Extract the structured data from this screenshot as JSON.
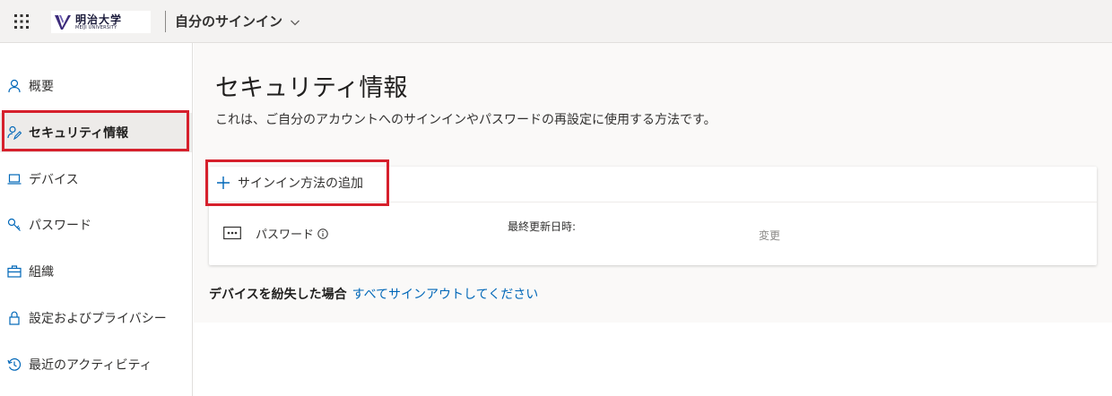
{
  "header": {
    "logo": {
      "name_jp": "明治大学",
      "name_en": "MEIJI UNIVERSITY"
    },
    "app_title": "自分のサインイン",
    "icons": {
      "waffle": "waffle-icon",
      "chevron": "chevron-down-icon"
    }
  },
  "sidebar": {
    "items": [
      {
        "label": "概要",
        "icon": "person-icon",
        "active": false
      },
      {
        "label": "セキュリティ情報",
        "icon": "security-info-icon",
        "active": true
      },
      {
        "label": "デバイス",
        "icon": "laptop-icon",
        "active": false
      },
      {
        "label": "パスワード",
        "icon": "key-icon",
        "active": false
      },
      {
        "label": "組織",
        "icon": "briefcase-icon",
        "active": false
      },
      {
        "label": "設定およびプライバシー",
        "icon": "lock-icon",
        "active": false
      },
      {
        "label": "最近のアクティビティ",
        "icon": "history-icon",
        "active": false
      }
    ]
  },
  "main": {
    "title": "セキュリティ情報",
    "description": "これは、ご自分のアカウントへのサインインやパスワードの再設定に使用する方法です。",
    "add_method_label": "サインイン方法の追加",
    "methods": [
      {
        "name": "パスワード",
        "icon": "password-dots-icon",
        "last_updated_label": "最終更新日時:",
        "action_label": "変更"
      }
    ],
    "lost_device": {
      "question": "デバイスを紛失した場合",
      "link": "すべてサインアウトしてください"
    }
  },
  "colors": {
    "accent": "#0067b8",
    "highlight": "#d6202c",
    "active_nav": "#edebe9"
  }
}
